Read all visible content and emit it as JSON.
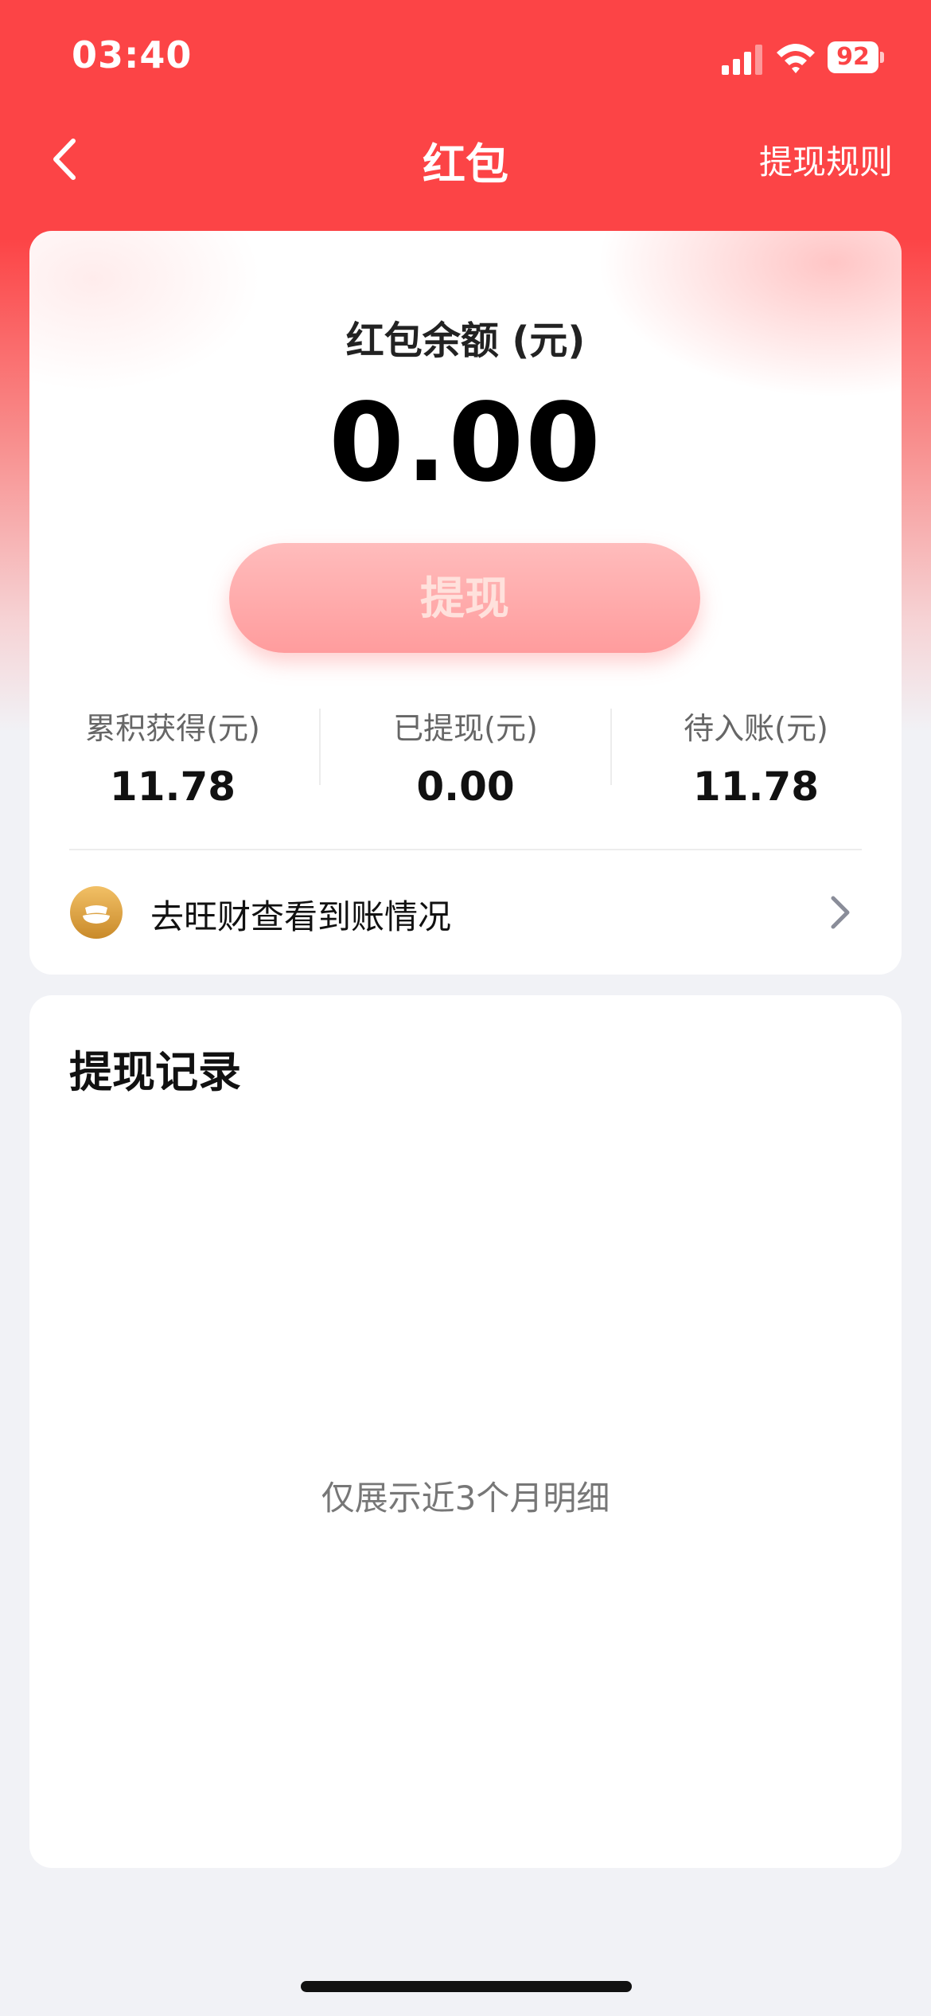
{
  "status_bar": {
    "time": "03:40",
    "battery": "92"
  },
  "nav": {
    "title": "红包",
    "rules_link": "提现规则"
  },
  "balance": {
    "label": "红包余额 (元)",
    "amount": "0.00",
    "withdraw_button": "提现"
  },
  "stats": [
    {
      "label": "累积获得(元)",
      "value": "11.78"
    },
    {
      "label": "已提现(元)",
      "value": "0.00"
    },
    {
      "label": "待入账(元)",
      "value": "11.78"
    }
  ],
  "wangcai": {
    "text": "去旺财查看到账情况"
  },
  "records": {
    "title": "提现记录",
    "empty_hint": "仅展示近3个月明细"
  },
  "icons": {
    "back": "chevron-left-icon",
    "coin": "gold-ingot-icon",
    "chevron": "chevron-right-icon",
    "signal": "cellular-signal-icon",
    "wifi": "wifi-icon"
  },
  "colors": {
    "brand_red": "#fc4446",
    "button_pink": "#ffa9aa",
    "coin_gold": "#d9a03e"
  }
}
